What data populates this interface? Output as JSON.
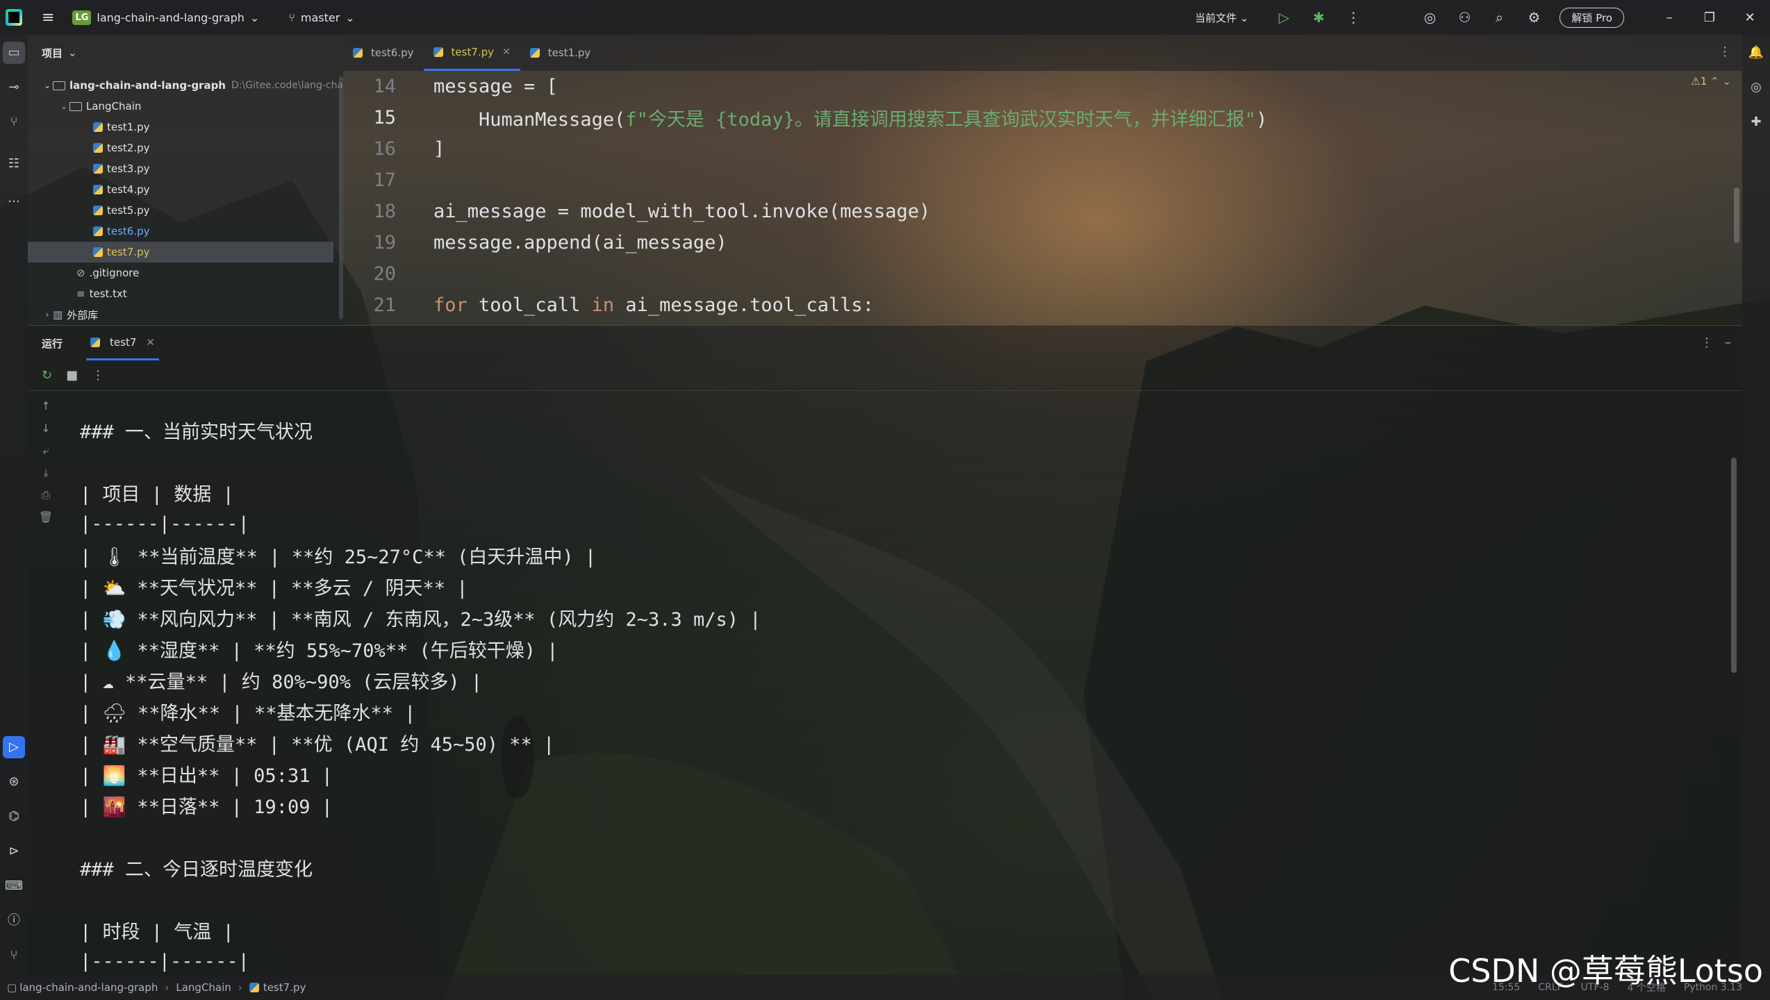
{
  "titlebar": {
    "project_badge": "LG",
    "project_name": "lang-chain-and-lang-graph",
    "branch": "master",
    "run_config": "当前文件",
    "pro_button": "解锁 Pro"
  },
  "project_panel": {
    "title": "项目",
    "root": {
      "name": "lang-chain-and-lang-graph",
      "path": "D:\\Gitee.code\\lang-cha"
    },
    "folder": "LangChain",
    "files": [
      "test1.py",
      "test2.py",
      "test3.py",
      "test4.py",
      "test5.py",
      "test6.py",
      "test7.py"
    ],
    "extra_files": [
      ".gitignore",
      "test.txt"
    ],
    "external": "外部库"
  },
  "editor": {
    "tabs": [
      {
        "label": "test6.py"
      },
      {
        "label": "test7.py"
      },
      {
        "label": "test1.py"
      }
    ],
    "warning_count": "1",
    "lines": [
      {
        "no": "14",
        "code": "message = ["
      },
      {
        "no": "15",
        "pre": "    HumanMessage(",
        "str": "f\"今天是 {today}。请直接调用搜索工具查询武汉实时天气，并详细汇报\"",
        "post": ")"
      },
      {
        "no": "16",
        "code": "]"
      },
      {
        "no": "17",
        "code": ""
      },
      {
        "no": "18",
        "code": "ai_message = model_with_tool.invoke(message)"
      },
      {
        "no": "19",
        "code": "message.append(ai_message)"
      },
      {
        "no": "20",
        "code": ""
      },
      {
        "no": "21",
        "kw1": "for",
        "mid": " tool_call ",
        "kw2": "in",
        "post": " ai_message.tool_calls:"
      }
    ]
  },
  "run_panel": {
    "label": "运行",
    "tab": "test7",
    "console": [
      "### 一、当前实时天气状况",
      "",
      "| 项目 | 数据 |",
      "|------|------|",
      "| 🌡 **当前温度** | **约 25~27°C** (白天升温中) |",
      "| ⛅ **天气状况** | **多云 / 阴天** |",
      "| 💨 **风向风力** | **南风 / 东南风，2~3级** (风力约 2~3.3 m/s) |",
      "| 💧 **湿度** | **约 55%~70%** (午后较干燥) |",
      "| ☁ **云量** | 约 80%~90% (云层较多) |",
      "| 🌧 **降水** | **基本无降水** |",
      "| 🏭 **空气质量** | **优 (AQI 约 45~50) ** |",
      "| 🌅 **日出** | 05:31 |",
      "| 🌇 **日落** | 19:09 |",
      "",
      "### 二、今日逐时温度变化",
      "",
      "| 时段 | 气温 |",
      "|------|------|"
    ]
  },
  "statusbar": {
    "crumbs": [
      "lang-chain-and-lang-graph",
      "LangChain",
      "test7.py"
    ],
    "position": "15:55",
    "line_sep": "CRLF",
    "encoding": "UTF-8",
    "indent": "4 个空格",
    "interpreter": "Python 3.13"
  },
  "watermark": "CSDN @草莓熊Lotso"
}
